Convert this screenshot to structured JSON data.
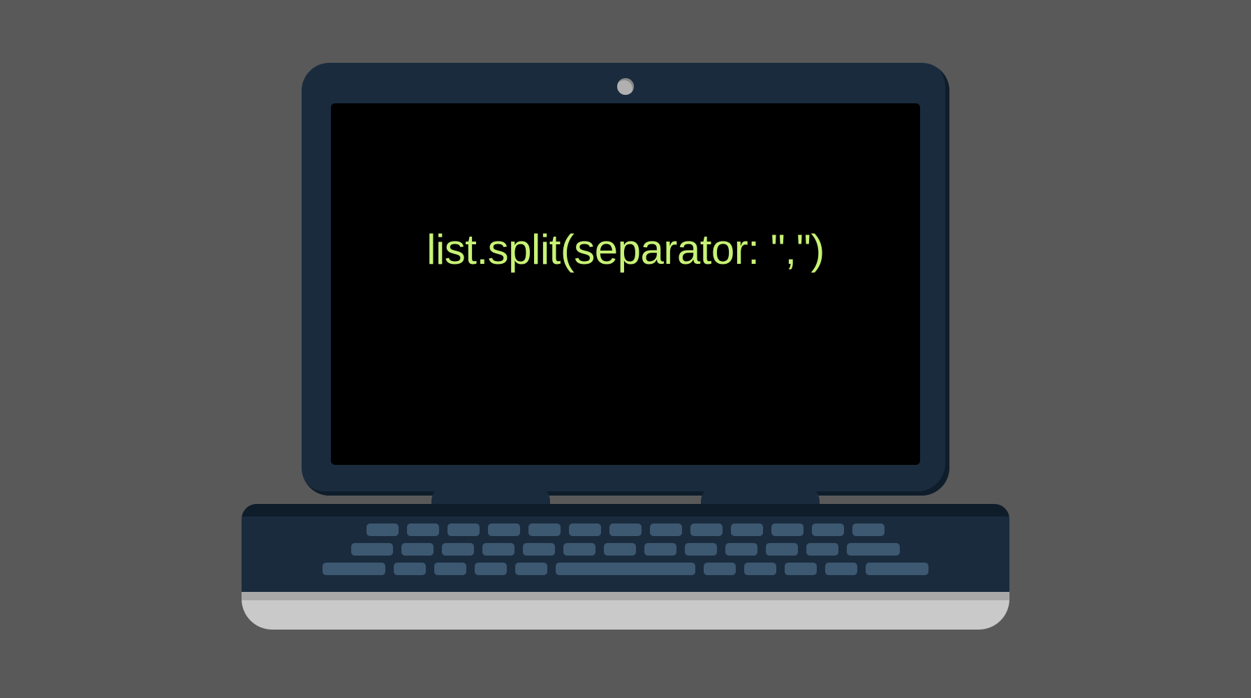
{
  "screen": {
    "code_line": "list.split(separator: \",\")"
  },
  "colors": {
    "background": "#595959",
    "bezel": "#1a2b3d",
    "screen": "#000000",
    "code_text": "#c8f276",
    "key": "#3d5871",
    "base": "#c9c9c9"
  }
}
